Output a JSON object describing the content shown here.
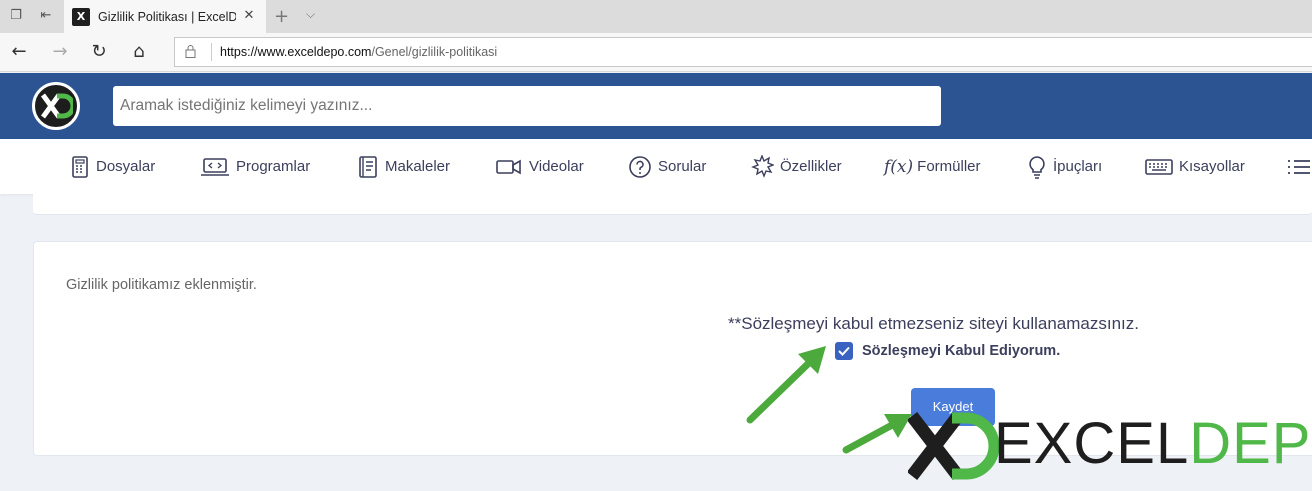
{
  "browser": {
    "tab_title": "Gizlilik Politikası | ExcelD",
    "favicon_text": "X",
    "url_host": "https://www.exceldepo.com",
    "url_path": "/Genel/gizlilik-politikasi"
  },
  "site": {
    "search_placeholder": "Aramak istediğiniz kelimeyi yazınız...",
    "menu": [
      {
        "label": "Dosyalar",
        "icon": "spreadsheet-icon"
      },
      {
        "label": "Programlar",
        "icon": "laptop-code-icon"
      },
      {
        "label": "Makaleler",
        "icon": "book-icon"
      },
      {
        "label": "Videolar",
        "icon": "video-camera-icon"
      },
      {
        "label": "Sorular",
        "icon": "question-circle-icon"
      },
      {
        "label": "Özellikler",
        "icon": "starburst-icon"
      },
      {
        "label": "Formüller",
        "icon": "function-icon"
      },
      {
        "label": "İpuçları",
        "icon": "lightbulb-icon"
      },
      {
        "label": "Kısayollar",
        "icon": "keyboard-icon"
      }
    ]
  },
  "content": {
    "policy_text": "Gizlilik politikamız eklenmiştir.",
    "warning": "**Sözleşmeyi kabul etmezseniz siteyi kullanamazsınız.",
    "accept_label": "Sözleşmeyi Kabul Ediyorum.",
    "accept_checked": true,
    "save_label": "Kaydet"
  },
  "watermark": {
    "text_part1": "EXCEL",
    "text_part2": "DEPO"
  },
  "colors": {
    "header_bg": "#2d5492",
    "accent_blue": "#4a7cdb",
    "brand_green": "#4fb848"
  }
}
